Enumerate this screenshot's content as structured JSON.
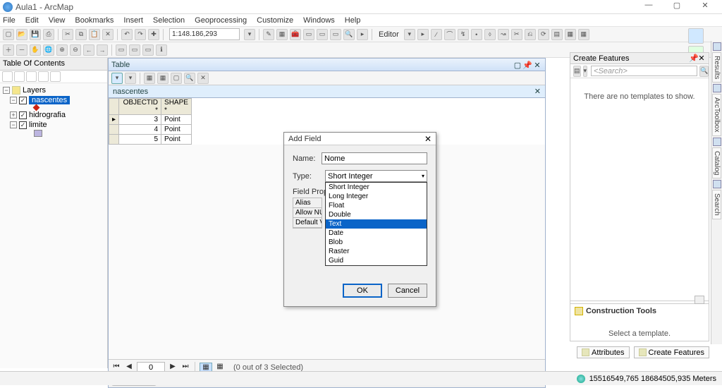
{
  "window": {
    "title": "Aula1 - ArcMap"
  },
  "menu": [
    "File",
    "Edit",
    "View",
    "Bookmarks",
    "Insert",
    "Selection",
    "Geoprocessing",
    "Customize",
    "Windows",
    "Help"
  ],
  "toolbar": {
    "scale": "1:148.186,293",
    "editor_label": "Editor"
  },
  "toc": {
    "title": "Table Of Contents",
    "root": "Layers",
    "layers": [
      {
        "name": "nascentes",
        "selected": true,
        "symbol": "point"
      },
      {
        "name": "hidrografia",
        "selected": false,
        "symbol": "none"
      },
      {
        "name": "limite",
        "selected": false,
        "symbol": "box"
      }
    ]
  },
  "table": {
    "title": "Table",
    "name": "nascentes",
    "columns": [
      "OBJECTID *",
      "SHAPE *"
    ],
    "rows": [
      {
        "oid": "3",
        "shape": "Point"
      },
      {
        "oid": "4",
        "shape": "Point"
      },
      {
        "oid": "5",
        "shape": "Point"
      }
    ],
    "nav_index": "0",
    "selection_text": "(0 out of 3 Selected)",
    "tab": "nascentes"
  },
  "dialog": {
    "title": "Add Field",
    "name_label": "Name:",
    "name_value": "Nome",
    "type_label": "Type:",
    "type_value": "Short Integer",
    "type_options": [
      "Short Integer",
      "Long Integer",
      "Float",
      "Double",
      "Text",
      "Date",
      "Blob",
      "Raster",
      "Guid"
    ],
    "highlight_option": "Text",
    "field_props_label": "Field Properties",
    "field_props": [
      "Alias",
      "Allow NULL",
      "Default Value"
    ],
    "ok": "OK",
    "cancel": "Cancel"
  },
  "create_features": {
    "title": "Create Features",
    "search_placeholder": "<Search>",
    "empty_text": "There are no templates to show.",
    "construction_title": "Construction Tools",
    "construction_msg": "Select a template."
  },
  "right_tabs": [
    "Results",
    "ArcToolbox",
    "Catalog",
    "Search"
  ],
  "bottom_tabs": {
    "attributes": "Attributes",
    "create": "Create Features"
  },
  "status": {
    "coords": "15516549,765 18684505,935 Meters"
  }
}
